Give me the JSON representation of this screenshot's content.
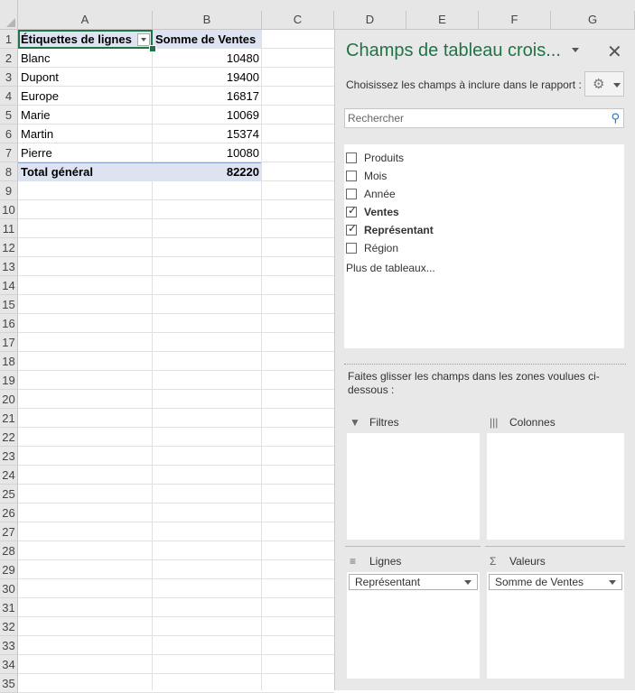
{
  "sheet": {
    "columns": [
      "A",
      "B",
      "C",
      "D",
      "E",
      "F",
      "G"
    ],
    "rows": [
      "1",
      "2",
      "3",
      "4",
      "5",
      "6",
      "7",
      "8",
      "9",
      "10",
      "11",
      "12",
      "13",
      "14",
      "15",
      "16",
      "17",
      "18",
      "19",
      "20",
      "21",
      "22",
      "23",
      "24",
      "25",
      "26",
      "27",
      "28",
      "29",
      "30",
      "31",
      "32",
      "33",
      "34",
      "35"
    ],
    "pivot": {
      "header_row_labels": "Étiquettes de lignes",
      "header_values": "Somme de Ventes",
      "rows": [
        {
          "label": "Blanc",
          "value": "10480"
        },
        {
          "label": "Dupont",
          "value": "19400"
        },
        {
          "label": "Europe",
          "value": "16817"
        },
        {
          "label": "Marie",
          "value": "10069"
        },
        {
          "label": "Martin",
          "value": "15374"
        },
        {
          "label": "Pierre",
          "value": "10080"
        }
      ],
      "total_label": "Total général",
      "total_value": "82220"
    }
  },
  "pane": {
    "title": "Champs de tableau crois...",
    "close_glyph": "✕",
    "subtitle": "Choisissez les champs à inclure dans le rapport :",
    "gear_glyph": "⚙",
    "search_placeholder": "Rechercher",
    "search_glyph": "⚲",
    "fields": [
      {
        "label": "Produits",
        "checked": false
      },
      {
        "label": "Mois",
        "checked": false
      },
      {
        "label": "Année",
        "checked": false
      },
      {
        "label": "Ventes",
        "checked": true
      },
      {
        "label": "Représentant",
        "checked": true
      },
      {
        "label": "Région",
        "checked": false
      }
    ],
    "more_tables": "Plus de tableaux...",
    "drag_text": "Faites glisser les champs dans les zones voulues ci-dessous :",
    "zones": {
      "filters": {
        "label": "Filtres",
        "icon": "▼"
      },
      "columns": {
        "label": "Colonnes",
        "icon": "|||"
      },
      "rows": {
        "label": "Lignes",
        "icon": "≡",
        "chip": "Représentant"
      },
      "values": {
        "label": "Valeurs",
        "icon": "Σ",
        "chip": "Somme de Ventes"
      }
    }
  }
}
